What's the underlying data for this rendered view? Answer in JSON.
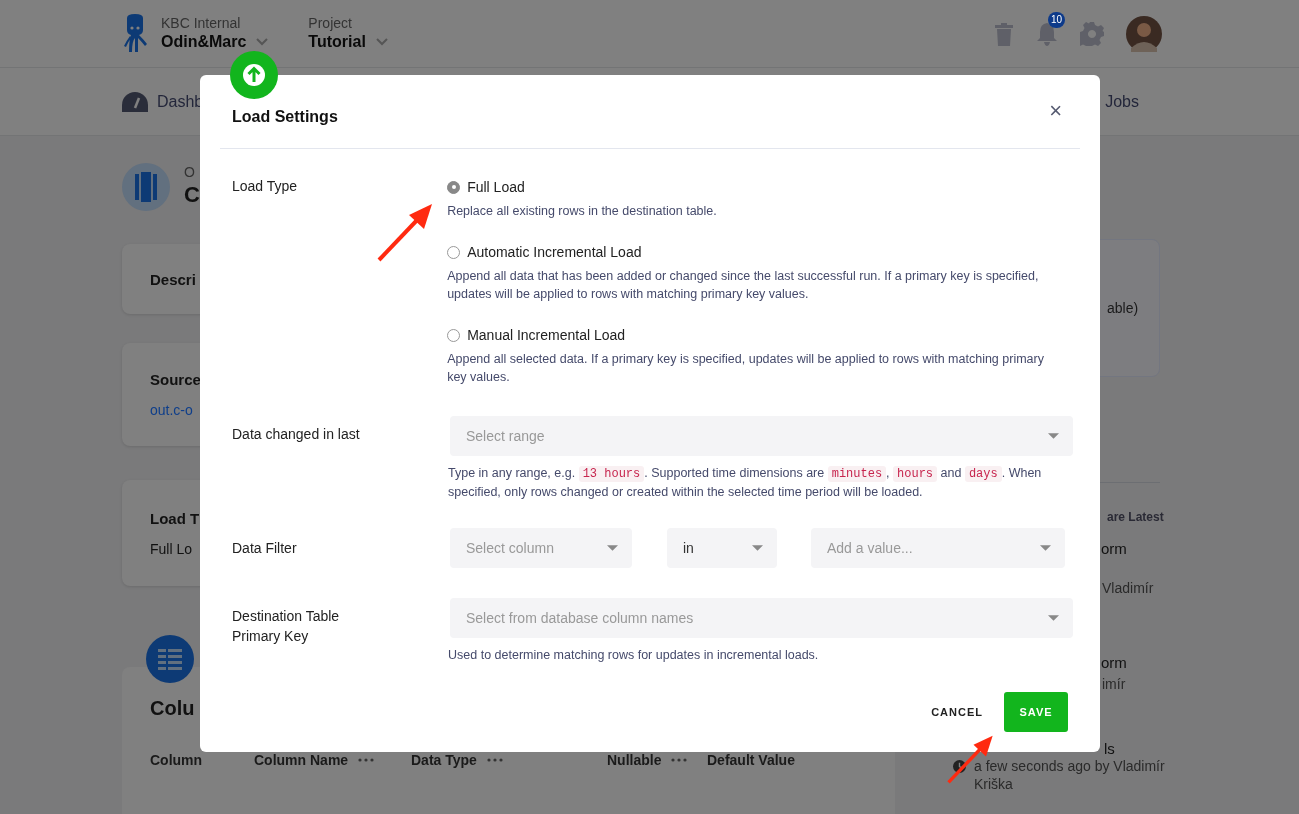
{
  "header": {
    "organization": {
      "caption": "KBC Internal",
      "name": "Odin&Marc"
    },
    "project": {
      "caption": "Project",
      "name": "Tutorial"
    },
    "notifications_badge": "10"
  },
  "nav": {
    "items": [
      {
        "label": "Dashb",
        "has_icon": true
      },
      {
        "label": "Jobs",
        "has_icon": false
      }
    ]
  },
  "overview": {
    "caption": "O",
    "title": "C"
  },
  "cards": [
    {
      "title": "Descri"
    },
    {
      "title": "Source",
      "link": "out.c-o"
    },
    {
      "title": "Load T",
      "value": "Full Lo"
    }
  ],
  "columns_section": {
    "title": "Colu",
    "headers": [
      {
        "label": "Column",
        "menu": false
      },
      {
        "label": "Column Name",
        "menu": true
      },
      {
        "label": "Data Type",
        "menu": true
      },
      {
        "label": "Nullable",
        "menu": true
      },
      {
        "label": "Default Value",
        "menu": false
      }
    ]
  },
  "side_panel": {
    "card_text": "able)",
    "heading": "are Latest",
    "events": [
      {
        "title": "orm",
        "lines": [
          "Vladimír"
        ],
        "clock": false
      },
      {
        "title": "orm",
        "lines": [
          "imír"
        ],
        "clock": false
      },
      {
        "title": "ls",
        "lines": [
          "a few seconds ago by Vladimír",
          "Kriška"
        ],
        "clock": true
      }
    ]
  },
  "modal": {
    "title": "Load Settings",
    "close": "×",
    "fields": [
      {
        "kind": "radio_group",
        "label": "Load Type",
        "options": [
          {
            "label": "Full Load",
            "description": "Replace all existing rows in the destination table.",
            "selected": true
          },
          {
            "label": "Automatic Incremental Load",
            "description": "Append all data that has been added or changed since the last successful run. If a primary key is specified, updates will be applied to rows with matching primary key values.",
            "selected": false
          },
          {
            "label": "Manual Incremental Load",
            "description": "Append all selected data. If a primary key is specified, updates will be applied to rows with matching primary key values.",
            "selected": false
          }
        ]
      },
      {
        "kind": "select",
        "label": "Data changed in last",
        "placeholder": "Select range",
        "help": [
          {
            "kind": "text",
            "text": "Type in any range, e.g. "
          },
          {
            "kind": "code",
            "text": "13 hours"
          },
          {
            "kind": "text",
            "text": ". Supported time dimensions are "
          },
          {
            "kind": "code",
            "text": "minutes"
          },
          {
            "kind": "text",
            "text": ", "
          },
          {
            "kind": "code",
            "text": "hours"
          },
          {
            "kind": "text",
            "text": " and "
          },
          {
            "kind": "code",
            "text": "days"
          },
          {
            "kind": "text",
            "text": ". When specified, only rows changed or created within the selected time period will be loaded."
          }
        ]
      },
      {
        "kind": "filter",
        "label": "Data Filter",
        "selects": [
          {
            "placeholder": "Select column"
          },
          {
            "value": "in"
          },
          {
            "placeholder": "Add a value..."
          }
        ]
      },
      {
        "kind": "select",
        "label": "Destination Table Primary Key",
        "placeholder": "Select from database column names",
        "help": [
          {
            "kind": "text",
            "text": "Used to determine matching rows for updates in incremental loads."
          }
        ]
      }
    ],
    "buttons": [
      {
        "label": "CANCEL",
        "kind": "text"
      },
      {
        "label": "SAVE",
        "kind": "primary"
      }
    ]
  }
}
